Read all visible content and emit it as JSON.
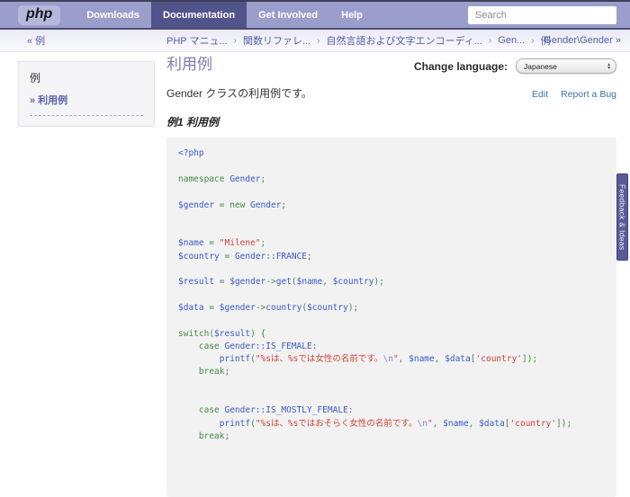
{
  "navbar": {
    "logo": "php",
    "items": [
      {
        "label": "Downloads",
        "active": false
      },
      {
        "label": "Documentation",
        "active": true
      },
      {
        "label": "Get Involved",
        "active": false
      },
      {
        "label": "Help",
        "active": false
      }
    ],
    "search_placeholder": "Search",
    "colors": {
      "bar": "#9B9DCA",
      "active_item": "#51548B",
      "dark_border": "#4B4E75",
      "logo_bg": "#B5B7DB"
    }
  },
  "breadcrumb": {
    "back_link": "« 例",
    "trail": [
      "PHP マニュ...",
      "関数リファレ...",
      "自然言語および文字エンコーディ...",
      "Gen...",
      "例"
    ],
    "separator": "›",
    "current": "Gender\\Gender »",
    "text_color": "#5A5EA5"
  },
  "sidebar": {
    "heading": "例",
    "items": [
      {
        "label": "» 利用例"
      }
    ]
  },
  "main": {
    "title": "利用例",
    "change_language_label": "Change language:",
    "language_selected": "Japanese",
    "description": "Gender クラスの利用例です。",
    "edit_link": "Edit",
    "report_link": "Report a Bug",
    "example_title": "例1 利用例",
    "title_color": "#7C7CB1",
    "link_color": "#3A76A9"
  },
  "feedback_tab": {
    "label": "Feedback & Ideas",
    "bg": "#585C96"
  },
  "code": {
    "background": "#F2F2F2",
    "colors": {
      "d": "#3C59C6",
      "k": "#458745",
      "s": "#CE4237",
      "e": "#8A8ABC"
    },
    "lines": [
      [
        [
          "d",
          "<?php"
        ]
      ],
      [],
      [
        [
          "k",
          "namespace "
        ],
        [
          "d",
          "Gender"
        ],
        [
          "k",
          ";"
        ]
      ],
      [],
      [
        [
          "d",
          "$gender"
        ],
        [
          "k",
          " = new "
        ],
        [
          "d",
          "Gender"
        ],
        [
          "k",
          ";"
        ]
      ],
      [],
      [],
      [
        [
          "d",
          "$name"
        ],
        [
          "k",
          " = "
        ],
        [
          "s",
          "\"Milene\""
        ],
        [
          "k",
          ";"
        ]
      ],
      [
        [
          "d",
          "$country"
        ],
        [
          "k",
          " = "
        ],
        [
          "d",
          "Gender::FRANCE"
        ],
        [
          "k",
          ";"
        ]
      ],
      [],
      [
        [
          "d",
          "$result"
        ],
        [
          "k",
          " = "
        ],
        [
          "d",
          "$gender"
        ],
        [
          "k",
          "->"
        ],
        [
          "d",
          "get"
        ],
        [
          "k",
          "("
        ],
        [
          "d",
          "$name"
        ],
        [
          "k",
          ", "
        ],
        [
          "d",
          "$country"
        ],
        [
          "k",
          ");"
        ]
      ],
      [],
      [
        [
          "d",
          "$data"
        ],
        [
          "k",
          " = "
        ],
        [
          "d",
          "$gender"
        ],
        [
          "k",
          "->"
        ],
        [
          "d",
          "country"
        ],
        [
          "k",
          "("
        ],
        [
          "d",
          "$country"
        ],
        [
          "k",
          ");"
        ]
      ],
      [],
      [
        [
          "k",
          "switch("
        ],
        [
          "d",
          "$result"
        ],
        [
          "k",
          ") {"
        ]
      ],
      [
        [
          "k",
          "    case "
        ],
        [
          "d",
          "Gender::IS_FEMALE"
        ],
        [
          "k",
          ":"
        ]
      ],
      [
        [
          "k",
          "        "
        ],
        [
          "d",
          "printf"
        ],
        [
          "k",
          "("
        ],
        [
          "s",
          "\"%sは、%sでは女性の名前です。"
        ],
        [
          "e",
          "\\n"
        ],
        [
          "s",
          "\""
        ],
        [
          "k",
          ", "
        ],
        [
          "d",
          "$name"
        ],
        [
          "k",
          ", "
        ],
        [
          "d",
          "$data"
        ],
        [
          "k",
          "["
        ],
        [
          "s",
          "'country'"
        ],
        [
          "k",
          "]);"
        ]
      ],
      [
        [
          "k",
          "    break;"
        ]
      ],
      [],
      [],
      [
        [
          "k",
          "    case "
        ],
        [
          "d",
          "Gender::IS_MOSTLY_FEMALE"
        ],
        [
          "k",
          ":"
        ]
      ],
      [
        [
          "k",
          "        "
        ],
        [
          "d",
          "printf"
        ],
        [
          "k",
          "("
        ],
        [
          "s",
          "\"%sは、%sではおそらく女性の名前です。"
        ],
        [
          "e",
          "\\n"
        ],
        [
          "s",
          "\""
        ],
        [
          "k",
          ", "
        ],
        [
          "d",
          "$name"
        ],
        [
          "k",
          ", "
        ],
        [
          "d",
          "$data"
        ],
        [
          "k",
          "["
        ],
        [
          "s",
          "'country'"
        ],
        [
          "k",
          "]);"
        ]
      ],
      [
        [
          "k",
          "    break;"
        ]
      ]
    ]
  }
}
